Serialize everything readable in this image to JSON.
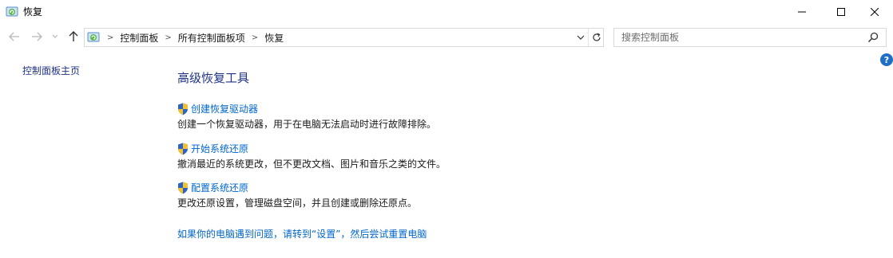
{
  "window": {
    "title": "恢复",
    "icon": "recovery-icon",
    "controls": [
      "minimize-icon",
      "maximize-icon",
      "close-icon"
    ]
  },
  "navigation": {
    "back_icon": "arrow-left-icon",
    "forward_icon": "arrow-right-icon",
    "recent_icon": "chevron-down-icon",
    "up_icon": "arrow-up-icon"
  },
  "address_bar": {
    "breadcrumbs": [
      "控制面板",
      "所有控制面板项",
      "恢复"
    ],
    "dropdown_icon": "chevron-down-icon",
    "refresh_icon": "refresh-icon"
  },
  "search": {
    "placeholder": "搜索控制面板",
    "value": "",
    "icon": "search-icon"
  },
  "help_label": "?",
  "left_pane": {
    "home_link": "控制面板主页"
  },
  "main": {
    "heading": "高级恢复工具",
    "tasks": [
      {
        "link": "创建恢复驱动器",
        "description": "创建一个恢复驱动器，用于在电脑无法启动时进行故障排除。",
        "icon": "uac-shield-icon"
      },
      {
        "link": "开始系统还原",
        "description": "撤消最近的系统更改，但不更改文档、图片和音乐之类的文件。",
        "icon": "uac-shield-icon"
      },
      {
        "link": "配置系统还原",
        "description": "更改还原设置，管理磁盘空间，并且创建或删除还原点。",
        "icon": "uac-shield-icon"
      }
    ],
    "footer_link": "如果你的电脑遇到问题，请转到“设置”，然后尝试重置电脑"
  },
  "colors": {
    "heading": "#1e3287",
    "link": "#0066cc",
    "help_badge": "#1f6fc4",
    "shield_blue": "#2b63c6",
    "shield_yellow": "#f2c230"
  }
}
